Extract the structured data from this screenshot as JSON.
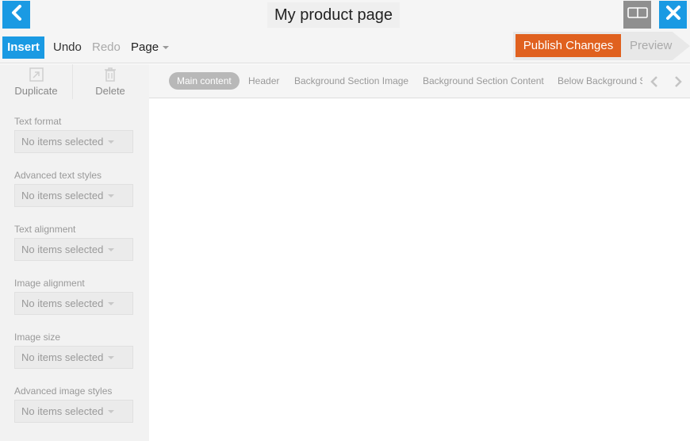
{
  "header": {
    "title": "My product page",
    "back_icon": "chevron-left-icon",
    "layout_icon": "split-view-icon",
    "close_icon": "close-icon"
  },
  "menu": {
    "insert": "Insert",
    "undo": "Undo",
    "redo": "Redo",
    "page": "Page"
  },
  "publish": {
    "publish_label": "Publish Changes",
    "preview_label": "Preview"
  },
  "sidebar": {
    "duplicate": "Duplicate",
    "delete": "Delete",
    "fields": [
      {
        "label": "Text format",
        "value": "No items selected"
      },
      {
        "label": "Advanced text styles",
        "value": "No items selected"
      },
      {
        "label": "Text alignment",
        "value": "No items selected"
      },
      {
        "label": "Image alignment",
        "value": "No items selected"
      },
      {
        "label": "Image size",
        "value": "No items selected"
      },
      {
        "label": "Advanced image styles",
        "value": "No items selected"
      }
    ]
  },
  "tabs": {
    "items": [
      {
        "label": "Main content"
      },
      {
        "label": "Header"
      },
      {
        "label": "Background Section Image"
      },
      {
        "label": "Background Section Content"
      },
      {
        "label": "Below Background Section"
      }
    ]
  },
  "colors": {
    "accent": "#1a9ae3",
    "publish": "#e0611f"
  }
}
